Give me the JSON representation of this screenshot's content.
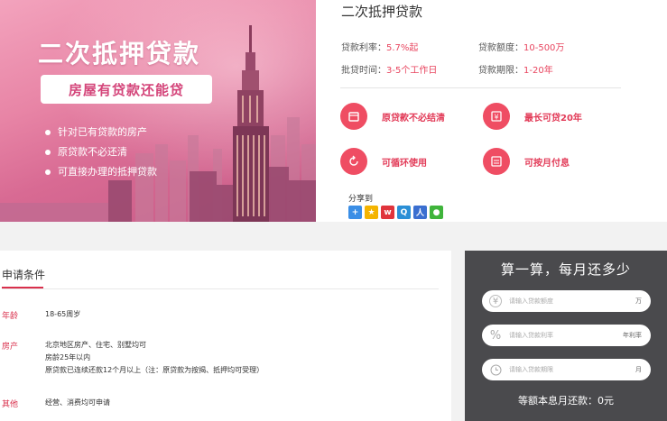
{
  "hero": {
    "title": "二次抵押贷款",
    "pill": "房屋有贷款还能贷",
    "bullets": [
      "针对已有贷款的房产",
      "原贷款不必还清",
      "可直接办理的抵押贷款"
    ]
  },
  "product": {
    "title": "二次抵押贷款",
    "specs": [
      {
        "key": "贷款利率：",
        "value": "5.7%起"
      },
      {
        "key": "贷款额度：",
        "value": "10-500万"
      },
      {
        "key": "批贷时间：",
        "value": "3-5个工作日"
      },
      {
        "key": "贷款期限：",
        "value": "1-20年"
      }
    ],
    "features": [
      {
        "icon": "house-icon",
        "label": "原贷款不必结清"
      },
      {
        "icon": "yen-icon",
        "label": "最长可贷20年"
      },
      {
        "icon": "refresh-icon",
        "label": "可循环使用"
      },
      {
        "icon": "calendar-icon",
        "label": "可按月付息"
      }
    ],
    "share_label": "分享到"
  },
  "conditions": {
    "title": "申请条件",
    "rows": [
      {
        "key": "年龄",
        "lines": [
          "18-65周岁"
        ]
      },
      {
        "key": "房产",
        "lines": [
          "北京地区房产、住宅、别墅均可",
          "房龄25年以内",
          "原贷款已连续还款12个月以上（注：原贷款为按揭、抵押均可受理）"
        ]
      },
      {
        "key": "其他",
        "lines": [
          "经营、消费均可申请"
        ]
      }
    ]
  },
  "calculator": {
    "title": "算一算，每月还多少",
    "inputs": [
      {
        "icon": "yen-icon",
        "placeholder": "请输入贷款额度",
        "unit": "万"
      },
      {
        "icon": "percent-icon",
        "placeholder": "请输入贷款利率",
        "unit": "年利率"
      },
      {
        "icon": "clock-icon",
        "placeholder": "请输入贷款期限",
        "unit": "月"
      }
    ],
    "result": "等额本息月还款：0元"
  },
  "colors": {
    "accent": "#ef4d63",
    "dark_panel": "#4a4a4d"
  }
}
